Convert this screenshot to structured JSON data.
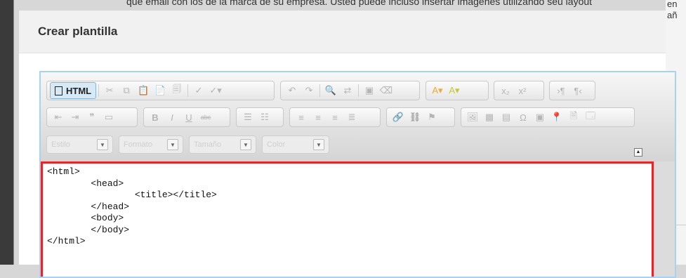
{
  "background": {
    "top_text": "que email con los de la marca de su empresa. Usted puede incluso insertar imágenes utilizando seu layout",
    "right_text_1": "en",
    "right_text_2": "añ"
  },
  "modal": {
    "title": "Crear plantilla"
  },
  "editor": {
    "html_button_label": "HTML",
    "dropdowns": [
      {
        "label": "Estilo"
      },
      {
        "label": "Formato"
      },
      {
        "label": "Tamaño"
      },
      {
        "label": "Color"
      }
    ],
    "code_lines": [
      "<html>",
      "        <head>",
      "                <title></title>",
      "        </head>",
      "        <body>",
      "        </body>",
      "</html>"
    ]
  }
}
